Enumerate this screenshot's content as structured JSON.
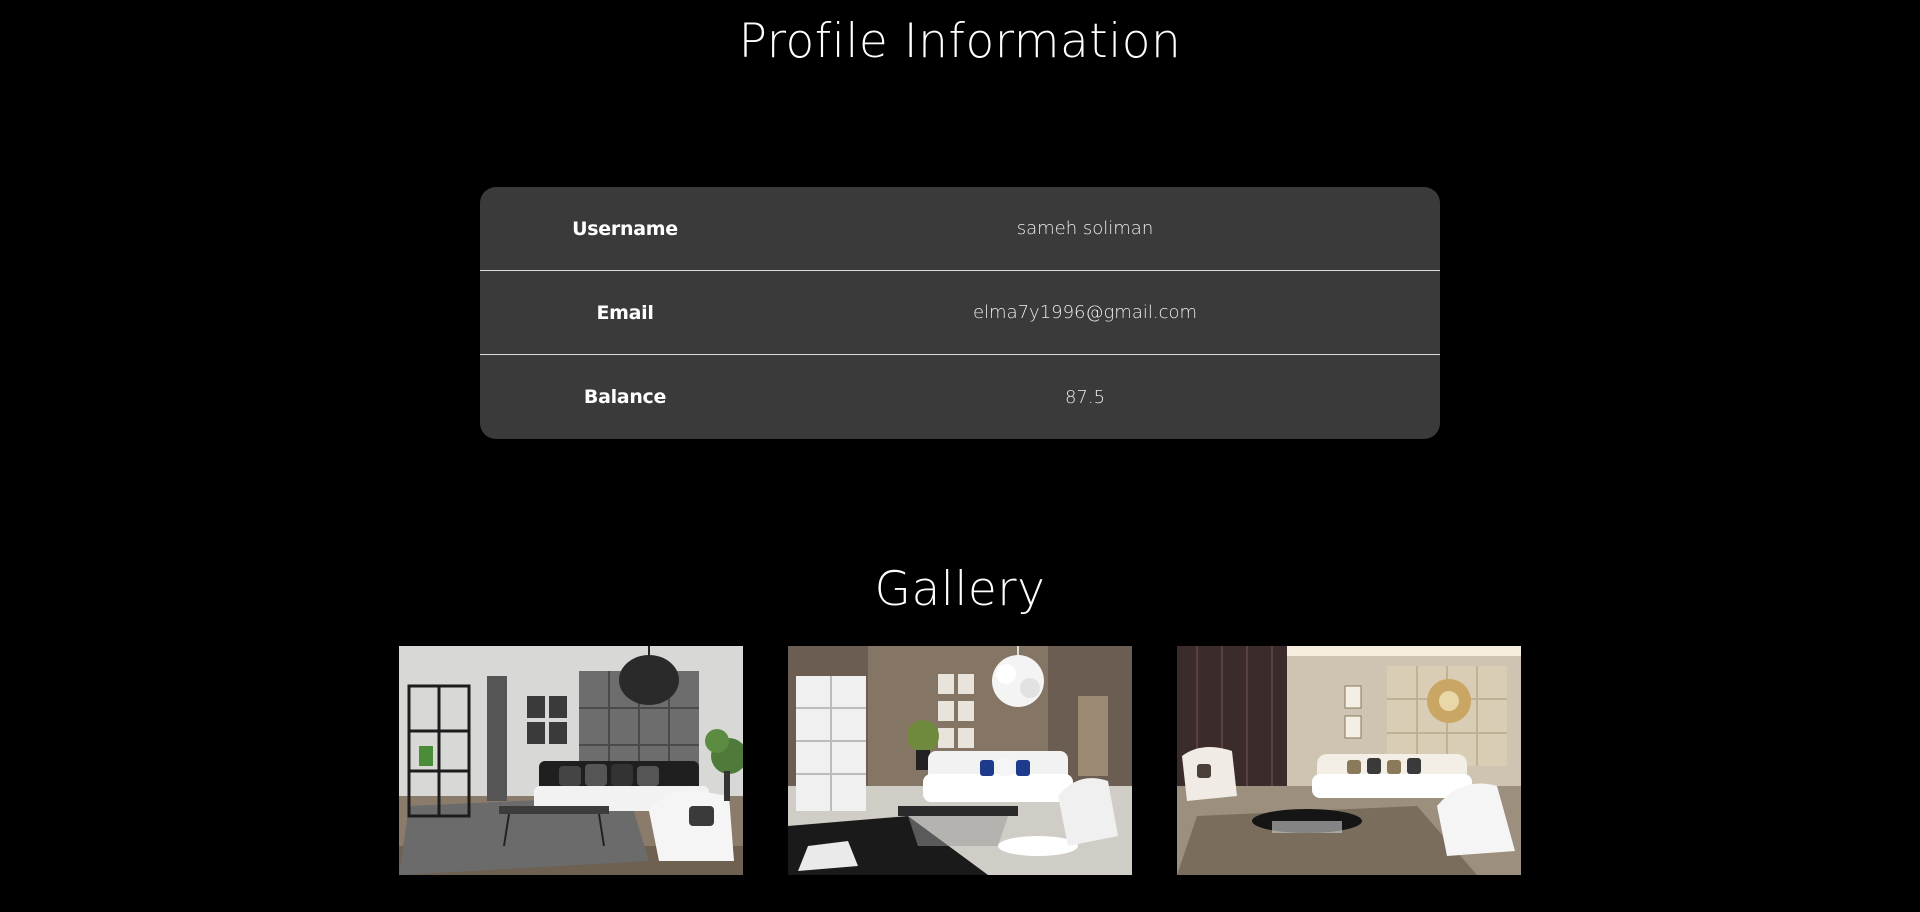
{
  "profile": {
    "title": "Profile Information",
    "rows": [
      {
        "label": "Username",
        "value": "sameh soliman"
      },
      {
        "label": "Email",
        "value": "elma7y1996@gmail.com"
      },
      {
        "label": "Balance",
        "value": "87.5"
      }
    ]
  },
  "gallery": {
    "title": "Gallery",
    "images": [
      {
        "name": "living-room-image-1"
      },
      {
        "name": "living-room-image-2"
      },
      {
        "name": "living-room-image-3"
      }
    ]
  },
  "colors": {
    "background": "#000000",
    "table_background": "#3a3a3a",
    "row_divider": "#d9d9d9",
    "text": "#ffffff"
  }
}
